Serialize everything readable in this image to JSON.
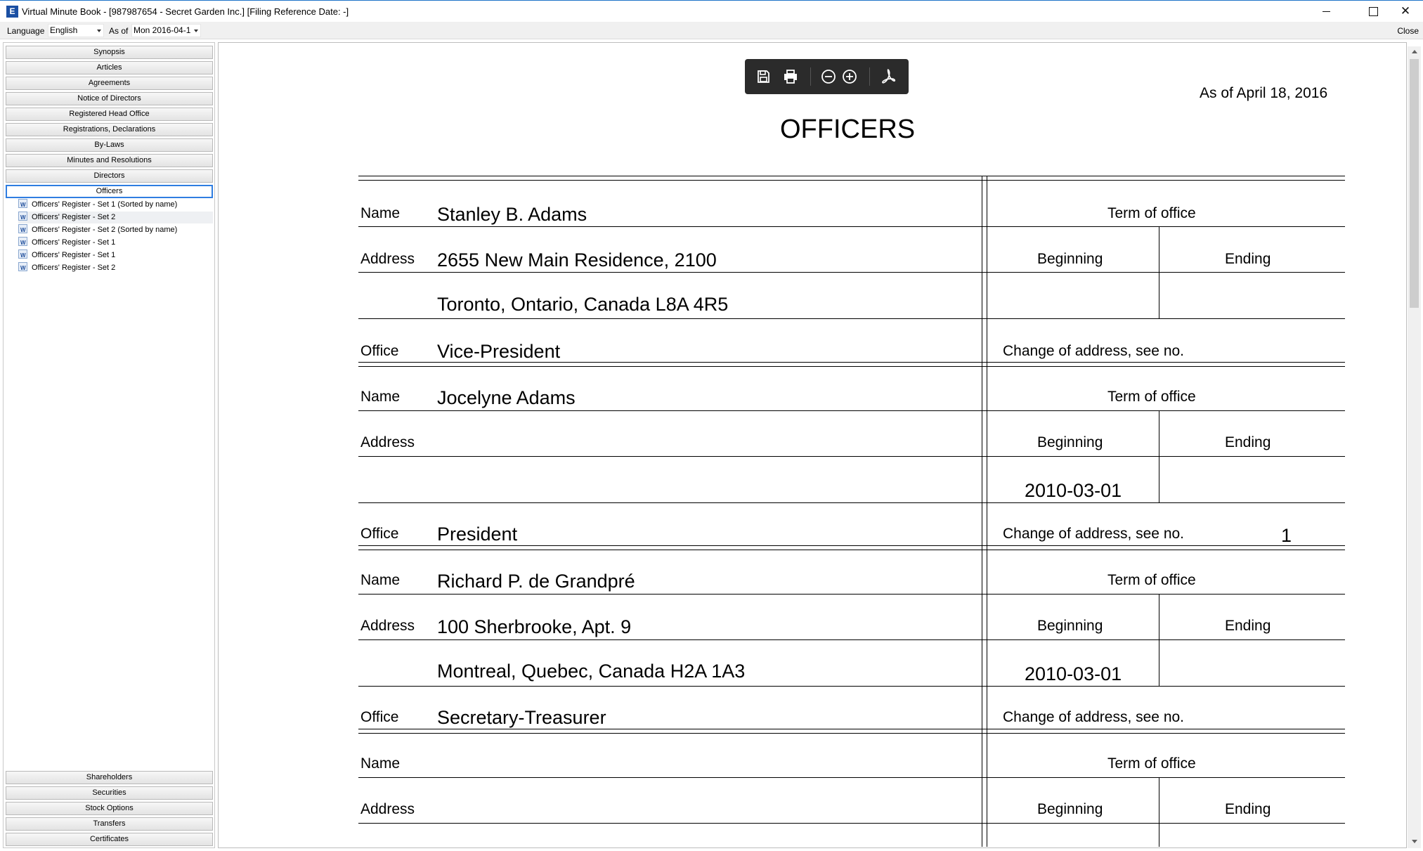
{
  "window": {
    "title": "Virtual Minute Book - [987987654 - Secret Garden Inc.]  [Filing Reference Date: -]",
    "app_icon": "E"
  },
  "toolbar": {
    "language_label": "Language",
    "language_value": "English",
    "as_of_label": "As of",
    "as_of_value": "Mon 2016-04-1",
    "close_label": "Close"
  },
  "sidebar": {
    "sections_top": [
      "Synopsis",
      "Articles",
      "Agreements",
      "Notice of Directors",
      "Registered Head Office",
      "Registrations, Declarations",
      "By-Laws",
      "Minutes and Resolutions",
      "Directors",
      "Officers"
    ],
    "active_section": "Officers",
    "documents": [
      "Officers' Register - Set 1 (Sorted by name)",
      "Officers' Register - Set 2",
      "Officers' Register - Set 2 (Sorted by name)",
      "Officers' Register - Set 1",
      "Officers' Register - Set 1",
      "Officers' Register - Set 2"
    ],
    "sections_bottom": [
      "Shareholders",
      "Securities",
      "Stock Options",
      "Transfers",
      "Certificates"
    ]
  },
  "pdf_toolbar": {
    "icons": [
      "save-icon",
      "print-icon",
      "zoom-out-icon",
      "zoom-in-icon",
      "pdf-icon"
    ]
  },
  "document": {
    "as_of": "As of April 18, 2016",
    "heading": "OFFICERS",
    "labels": {
      "name": "Name",
      "address": "Address",
      "office": "Office",
      "term_of_office": "Term of office",
      "beginning": "Beginning",
      "ending": "Ending",
      "change_of_address": "Change of address, see no."
    },
    "officers": [
      {
        "name": "Stanley B. Adams",
        "address_line1": "2655 New Main Residence, 2100",
        "address_line2": "Toronto, Ontario, Canada L8A 4R5",
        "office": "Vice-President",
        "beginning": "",
        "ending": "",
        "change_of_address_no": ""
      },
      {
        "name": "Jocelyne Adams",
        "address_line1": "",
        "address_line2": "",
        "office": "President",
        "beginning": "2010-03-01",
        "ending": "",
        "change_of_address_no": "1"
      },
      {
        "name": "Richard P. de Grandpré",
        "address_line1": "100 Sherbrooke, Apt. 9",
        "address_line2": "Montreal, Quebec, Canada H2A 1A3",
        "office": "Secretary-Treasurer",
        "beginning": "2010-03-01",
        "ending": "",
        "change_of_address_no": ""
      },
      {
        "name": "",
        "address_line1": "",
        "address_line2": "",
        "office": "",
        "beginning": "",
        "ending": "",
        "change_of_address_no": ""
      }
    ]
  }
}
